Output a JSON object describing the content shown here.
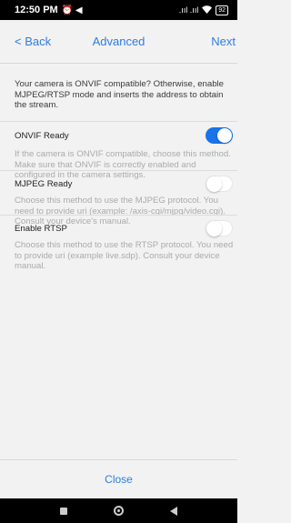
{
  "status_bar": {
    "time": "12:50 PM",
    "left_icons": "⏰ ◀",
    "signal": ".ııl .ııl",
    "wifi": "☰",
    "battery": "92"
  },
  "nav": {
    "back": "< Back",
    "title": "Advanced",
    "next": "Next"
  },
  "intro_text": "Your camera is ONVIF compatible? Otherwise, enable MJPEG/RTSP mode and inserts the address to obtain the stream.",
  "options": [
    {
      "label": "ONVIF Ready",
      "enabled": true,
      "description": "If the camera is ONVIF compatible, choose this method. Make sure that ONVIF is correctly enabled and configured in the camera settings."
    },
    {
      "label": "MJPEG Ready",
      "enabled": false,
      "description": "Choose this method to use the MJPEG protocol. You need to provide uri (example: /axis-cgi/mjpg/video.cgi). Consult your device's manual."
    },
    {
      "label": "Enable RTSP",
      "enabled": false,
      "description": "Choose this method to use the RTSP protocol. You need to provide uri (example live.sdp). Consult your device manual."
    }
  ],
  "close_label": "Close",
  "colors": {
    "accent": "#2f7de1",
    "toggle_on": "#1a73e8",
    "background": "#f2f2f2"
  }
}
